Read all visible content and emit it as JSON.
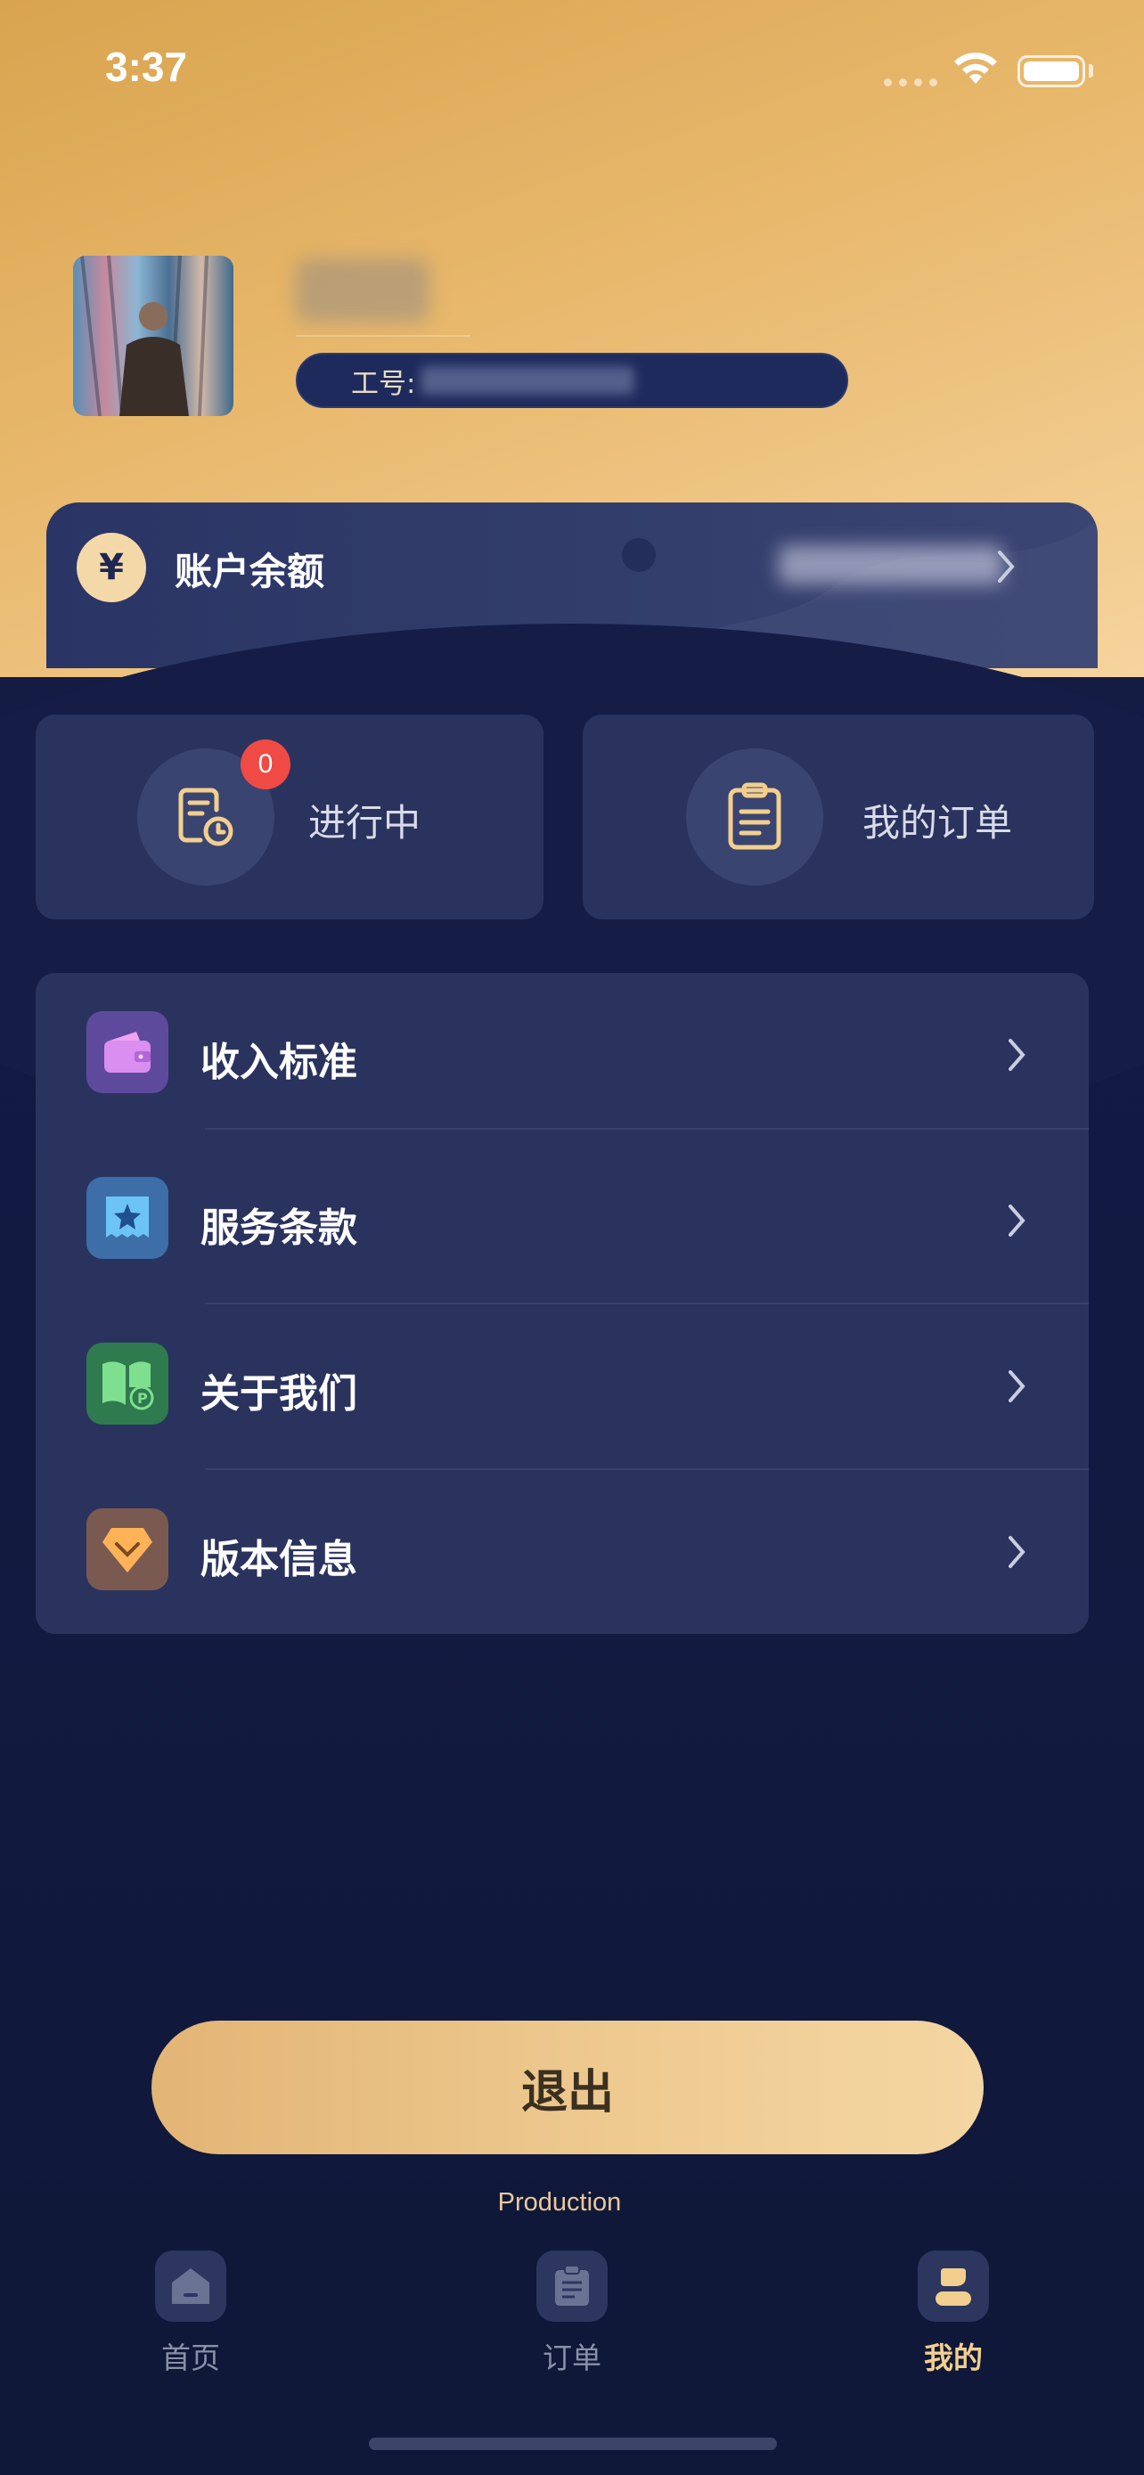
{
  "status_bar": {
    "time": "3:37"
  },
  "profile": {
    "id_label": "工号:"
  },
  "balance": {
    "label": "账户余额",
    "currency_symbol": "¥"
  },
  "quick_actions": [
    {
      "label": "进行中",
      "badge": "0",
      "icon": "order-clock-icon"
    },
    {
      "label": "我的订单",
      "icon": "clipboard-icon"
    }
  ],
  "menu": [
    {
      "label": "收入标准",
      "icon": "wallet-icon",
      "color": "#8a5ec8"
    },
    {
      "label": "服务条款",
      "icon": "star-ticket-icon",
      "color": "#3f79c4"
    },
    {
      "label": "关于我们",
      "icon": "book-icon",
      "color": "#3a9c62"
    },
    {
      "label": "版本信息",
      "icon": "diamond-icon",
      "color": "#e49148"
    }
  ],
  "logout_label": "退出",
  "environment": "Production",
  "tabs": [
    {
      "label": "首页",
      "icon": "home-icon",
      "active": false
    },
    {
      "label": "订单",
      "icon": "order-icon",
      "active": false
    },
    {
      "label": "我的",
      "icon": "profile-icon",
      "active": true
    }
  ],
  "colors": {
    "accent_gold": "#f2cf8e",
    "background_navy": "#151d47",
    "badge_red": "#ef4a44"
  }
}
